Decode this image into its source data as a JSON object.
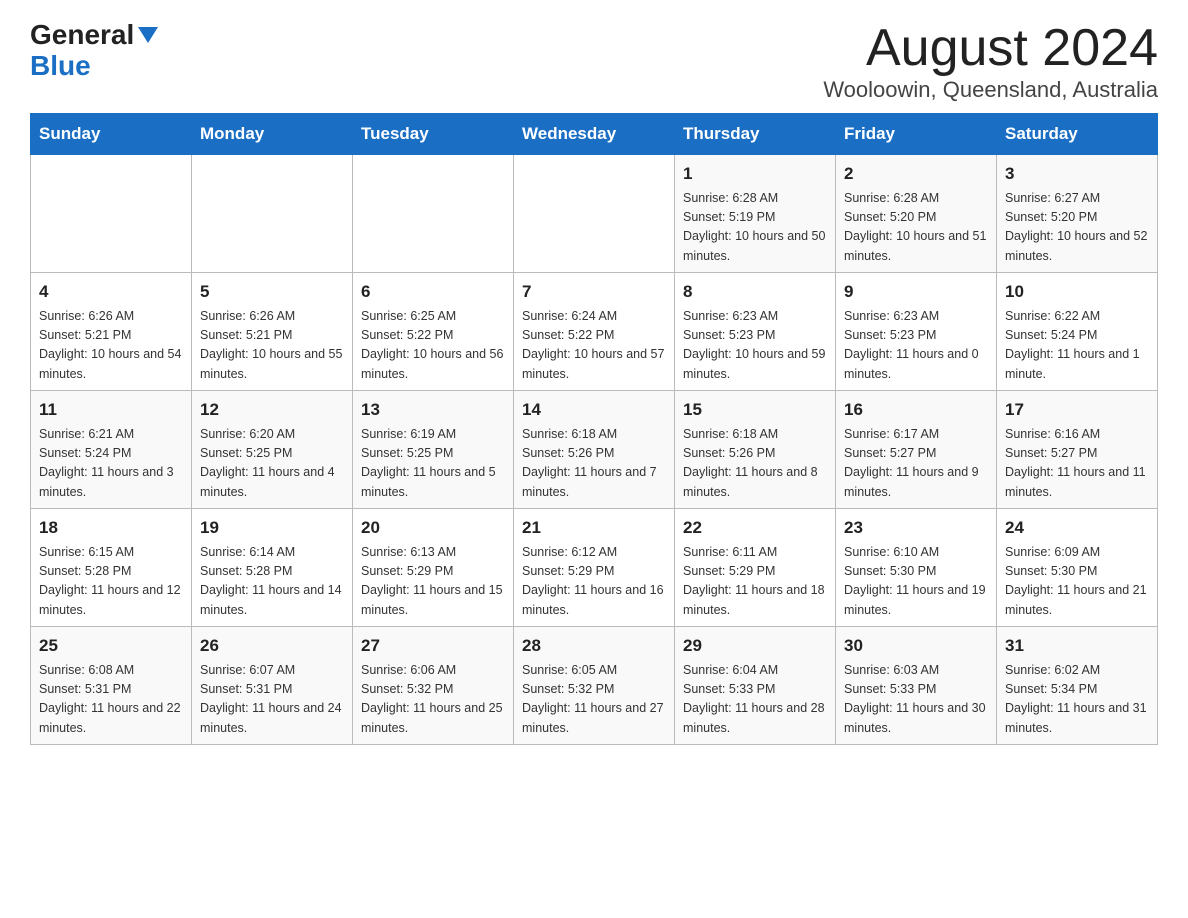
{
  "logo": {
    "general": "General",
    "blue": "Blue"
  },
  "title": "August 2024",
  "subtitle": "Wooloowin, Queensland, Australia",
  "weekdays": [
    "Sunday",
    "Monday",
    "Tuesday",
    "Wednesday",
    "Thursday",
    "Friday",
    "Saturday"
  ],
  "weeks": [
    [
      {
        "num": "",
        "info": ""
      },
      {
        "num": "",
        "info": ""
      },
      {
        "num": "",
        "info": ""
      },
      {
        "num": "",
        "info": ""
      },
      {
        "num": "1",
        "info": "Sunrise: 6:28 AM\nSunset: 5:19 PM\nDaylight: 10 hours and 50 minutes."
      },
      {
        "num": "2",
        "info": "Sunrise: 6:28 AM\nSunset: 5:20 PM\nDaylight: 10 hours and 51 minutes."
      },
      {
        "num": "3",
        "info": "Sunrise: 6:27 AM\nSunset: 5:20 PM\nDaylight: 10 hours and 52 minutes."
      }
    ],
    [
      {
        "num": "4",
        "info": "Sunrise: 6:26 AM\nSunset: 5:21 PM\nDaylight: 10 hours and 54 minutes."
      },
      {
        "num": "5",
        "info": "Sunrise: 6:26 AM\nSunset: 5:21 PM\nDaylight: 10 hours and 55 minutes."
      },
      {
        "num": "6",
        "info": "Sunrise: 6:25 AM\nSunset: 5:22 PM\nDaylight: 10 hours and 56 minutes."
      },
      {
        "num": "7",
        "info": "Sunrise: 6:24 AM\nSunset: 5:22 PM\nDaylight: 10 hours and 57 minutes."
      },
      {
        "num": "8",
        "info": "Sunrise: 6:23 AM\nSunset: 5:23 PM\nDaylight: 10 hours and 59 minutes."
      },
      {
        "num": "9",
        "info": "Sunrise: 6:23 AM\nSunset: 5:23 PM\nDaylight: 11 hours and 0 minutes."
      },
      {
        "num": "10",
        "info": "Sunrise: 6:22 AM\nSunset: 5:24 PM\nDaylight: 11 hours and 1 minute."
      }
    ],
    [
      {
        "num": "11",
        "info": "Sunrise: 6:21 AM\nSunset: 5:24 PM\nDaylight: 11 hours and 3 minutes."
      },
      {
        "num": "12",
        "info": "Sunrise: 6:20 AM\nSunset: 5:25 PM\nDaylight: 11 hours and 4 minutes."
      },
      {
        "num": "13",
        "info": "Sunrise: 6:19 AM\nSunset: 5:25 PM\nDaylight: 11 hours and 5 minutes."
      },
      {
        "num": "14",
        "info": "Sunrise: 6:18 AM\nSunset: 5:26 PM\nDaylight: 11 hours and 7 minutes."
      },
      {
        "num": "15",
        "info": "Sunrise: 6:18 AM\nSunset: 5:26 PM\nDaylight: 11 hours and 8 minutes."
      },
      {
        "num": "16",
        "info": "Sunrise: 6:17 AM\nSunset: 5:27 PM\nDaylight: 11 hours and 9 minutes."
      },
      {
        "num": "17",
        "info": "Sunrise: 6:16 AM\nSunset: 5:27 PM\nDaylight: 11 hours and 11 minutes."
      }
    ],
    [
      {
        "num": "18",
        "info": "Sunrise: 6:15 AM\nSunset: 5:28 PM\nDaylight: 11 hours and 12 minutes."
      },
      {
        "num": "19",
        "info": "Sunrise: 6:14 AM\nSunset: 5:28 PM\nDaylight: 11 hours and 14 minutes."
      },
      {
        "num": "20",
        "info": "Sunrise: 6:13 AM\nSunset: 5:29 PM\nDaylight: 11 hours and 15 minutes."
      },
      {
        "num": "21",
        "info": "Sunrise: 6:12 AM\nSunset: 5:29 PM\nDaylight: 11 hours and 16 minutes."
      },
      {
        "num": "22",
        "info": "Sunrise: 6:11 AM\nSunset: 5:29 PM\nDaylight: 11 hours and 18 minutes."
      },
      {
        "num": "23",
        "info": "Sunrise: 6:10 AM\nSunset: 5:30 PM\nDaylight: 11 hours and 19 minutes."
      },
      {
        "num": "24",
        "info": "Sunrise: 6:09 AM\nSunset: 5:30 PM\nDaylight: 11 hours and 21 minutes."
      }
    ],
    [
      {
        "num": "25",
        "info": "Sunrise: 6:08 AM\nSunset: 5:31 PM\nDaylight: 11 hours and 22 minutes."
      },
      {
        "num": "26",
        "info": "Sunrise: 6:07 AM\nSunset: 5:31 PM\nDaylight: 11 hours and 24 minutes."
      },
      {
        "num": "27",
        "info": "Sunrise: 6:06 AM\nSunset: 5:32 PM\nDaylight: 11 hours and 25 minutes."
      },
      {
        "num": "28",
        "info": "Sunrise: 6:05 AM\nSunset: 5:32 PM\nDaylight: 11 hours and 27 minutes."
      },
      {
        "num": "29",
        "info": "Sunrise: 6:04 AM\nSunset: 5:33 PM\nDaylight: 11 hours and 28 minutes."
      },
      {
        "num": "30",
        "info": "Sunrise: 6:03 AM\nSunset: 5:33 PM\nDaylight: 11 hours and 30 minutes."
      },
      {
        "num": "31",
        "info": "Sunrise: 6:02 AM\nSunset: 5:34 PM\nDaylight: 11 hours and 31 minutes."
      }
    ]
  ]
}
